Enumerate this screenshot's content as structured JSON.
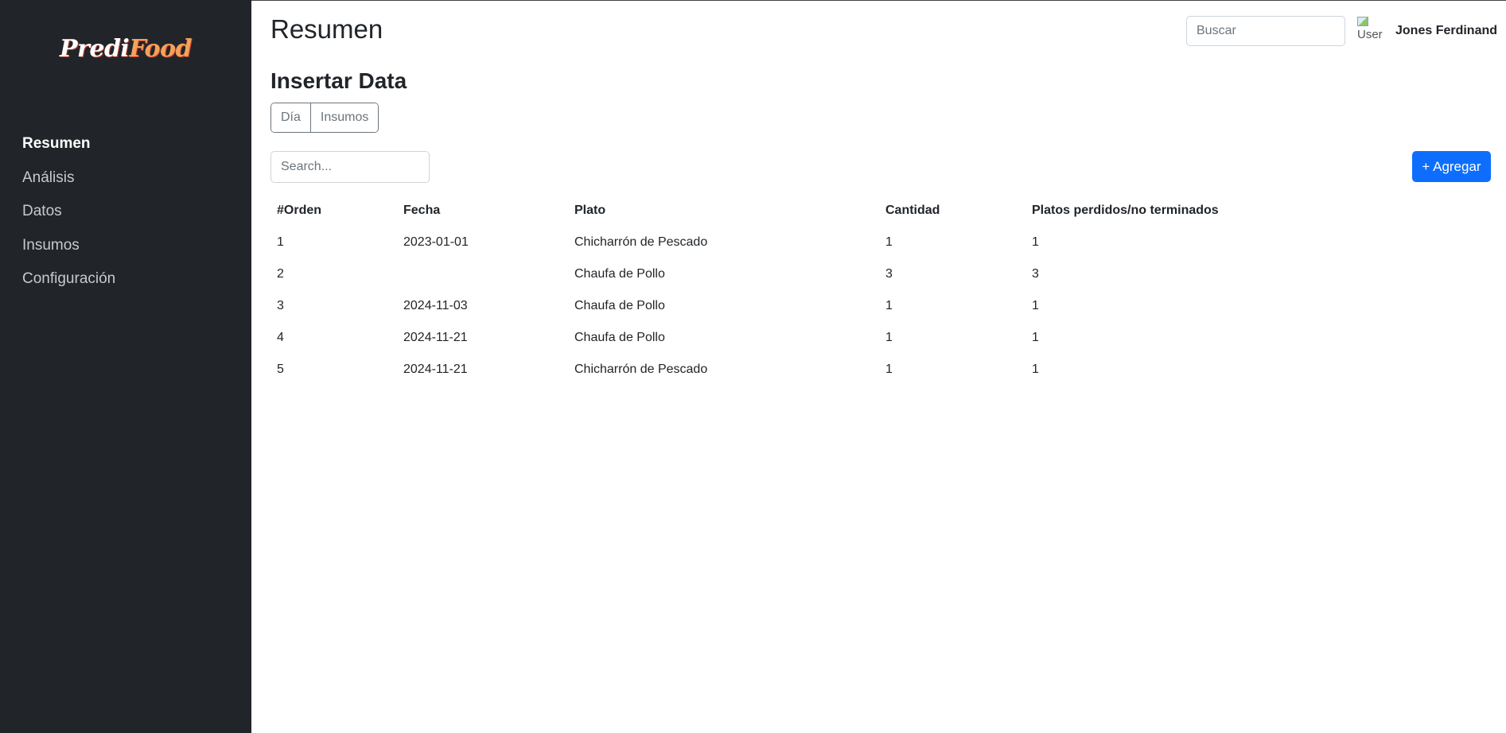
{
  "sidebar": {
    "logo_part1": "Predi",
    "logo_part2": "Food",
    "items": [
      {
        "label": "Resumen"
      },
      {
        "label": "Análisis"
      },
      {
        "label": "Datos"
      },
      {
        "label": "Insumos"
      },
      {
        "label": "Configuración"
      }
    ]
  },
  "header": {
    "title": "Resumen",
    "search_placeholder": "Buscar",
    "avatar_alt": "User",
    "user_name": "Jones Ferdinand"
  },
  "main": {
    "section_title": "Insertar Data",
    "tabs": [
      {
        "label": "Día"
      },
      {
        "label": "Insumos"
      }
    ],
    "search_placeholder": "Search...",
    "add_button": "+ Agregar",
    "table": {
      "columns": [
        "#Orden",
        "Fecha",
        "Plato",
        "Cantidad",
        "Platos perdidos/no terminados"
      ],
      "rows": [
        [
          "1",
          "2023-01-01",
          "Chicharrón de Pescado",
          "1",
          "1"
        ],
        [
          "2",
          "",
          "Chaufa de Pollo",
          "3",
          "3"
        ],
        [
          "3",
          "2024-11-03",
          "Chaufa de Pollo",
          "1",
          "1"
        ],
        [
          "4",
          "2024-11-21",
          "Chaufa de Pollo",
          "1",
          "1"
        ],
        [
          "5",
          "2024-11-21",
          "Chicharrón de Pescado",
          "1",
          "1"
        ]
      ]
    }
  },
  "colors": {
    "sidebar_bg": "#212529",
    "accent": "#0d6efd",
    "logo_accent": "#f4a259"
  }
}
